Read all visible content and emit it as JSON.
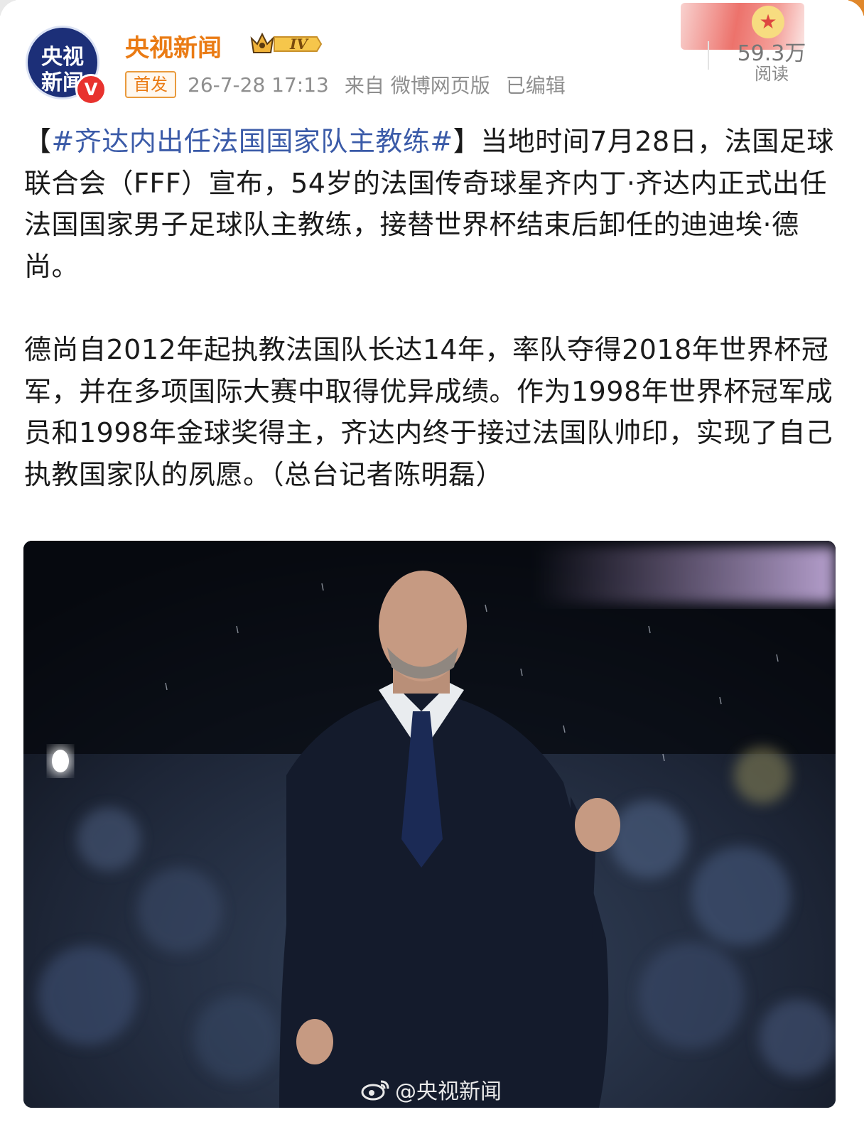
{
  "account": {
    "name": "央视新闻",
    "avatar_line1": "央视",
    "avatar_line2": "新闻",
    "verified_mark": "V",
    "vip_level": "IV"
  },
  "meta": {
    "first_badge": "首发",
    "timestamp": "26-7-28 17:13",
    "source": "来自 微博网页版",
    "edited": "已编辑"
  },
  "reads": {
    "count": "59.3万",
    "label": "阅读"
  },
  "post": {
    "topic": "#齐达内出任法国国家队主教练#",
    "p1_open": "【",
    "p1_close_and_text": "】当地时间7月28日，法国足球联合会（FFF）宣布，54岁的法国传奇球星齐内丁·齐达内正式出任法国国家男子足球队主教练，接替世界杯结束后卸任的迪迪埃·德尚。",
    "p2": "德尚自2012年起执教法国队长达14年，率队夺得2018年世界杯冠军，并在多项国际大赛中取得优异成绩。作为1998年世界杯冠军成员和1998年金球奖得主，齐达内终于接过法国队帅印，实现了自己执教国家队的夙愿。（总台记者陈明磊）"
  },
  "image": {
    "watermark": "@央视新闻"
  },
  "colors": {
    "accent_orange": "#ea7b14",
    "topic_blue": "#3b5ba8",
    "avatar_navy": "#1c2f78",
    "verified_red": "#e8322e"
  },
  "icons": [
    "avatar",
    "verified-v-icon",
    "vip-crown-icon",
    "weibo-logo-icon",
    "emblem-icon"
  ]
}
